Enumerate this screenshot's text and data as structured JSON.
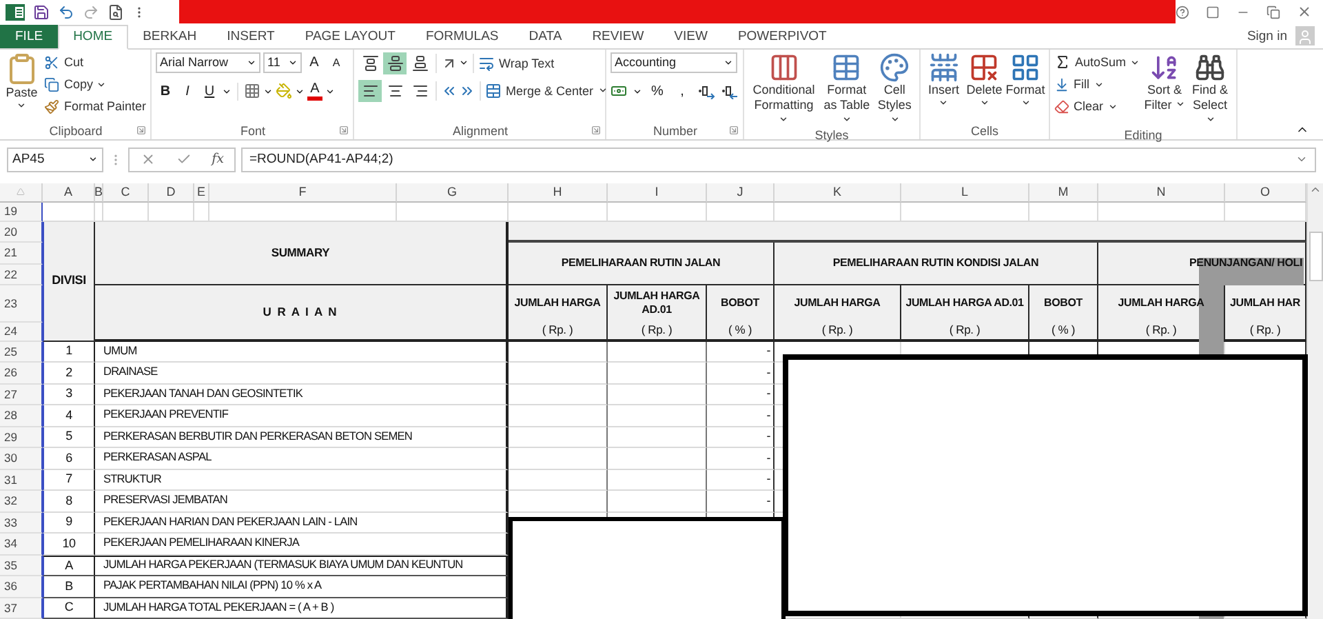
{
  "tabs": [
    {
      "label": "FILE",
      "kind": "file",
      "selected": false
    },
    {
      "label": "HOME",
      "kind": "tab",
      "selected": true
    },
    {
      "label": "BERKAH",
      "kind": "tab",
      "selected": false
    },
    {
      "label": "INSERT",
      "kind": "tab",
      "selected": false
    },
    {
      "label": "PAGE LAYOUT",
      "kind": "tab",
      "selected": false
    },
    {
      "label": "FORMULAS",
      "kind": "tab",
      "selected": false
    },
    {
      "label": "DATA",
      "kind": "tab",
      "selected": false
    },
    {
      "label": "REVIEW",
      "kind": "tab",
      "selected": false
    },
    {
      "label": "VIEW",
      "kind": "tab",
      "selected": false
    },
    {
      "label": "POWERPIVOT",
      "kind": "tab",
      "selected": false
    }
  ],
  "account": {
    "label": "Sign in"
  },
  "ribbon": {
    "clipboard": {
      "title": "Clipboard",
      "paste": "Paste",
      "cut": "Cut",
      "copy": "Copy",
      "format_painter": "Format Painter"
    },
    "font": {
      "title": "Font",
      "name": "Arial Narrow",
      "size": "11",
      "grow": "A",
      "shrink": "A",
      "bold": "B",
      "italic": "I",
      "underline": "U",
      "font_color": "A"
    },
    "alignment": {
      "title": "Alignment",
      "vertical": [
        {
          "kind": "top",
          "selected": false
        },
        {
          "kind": "middle",
          "selected": true
        },
        {
          "kind": "bottom",
          "selected": false
        }
      ],
      "horizontal": [
        {
          "kind": "left",
          "selected": true
        },
        {
          "kind": "center",
          "selected": false
        },
        {
          "kind": "right",
          "selected": false
        }
      ],
      "wrap_text": "Wrap Text",
      "merge": "Merge & Center"
    },
    "number": {
      "title": "Number",
      "format": "Accounting",
      "percent": "%",
      "comma": ","
    },
    "styles": {
      "title": "Styles",
      "buttons": [
        {
          "label": "Conditional Formatting",
          "kind": "conditional"
        },
        {
          "label": "Format as Table",
          "kind": "table"
        },
        {
          "label": "Cell Styles",
          "kind": "cell"
        }
      ]
    },
    "cells": {
      "title": "Cells",
      "buttons": [
        {
          "label": "Insert",
          "kind": "insert"
        },
        {
          "label": "Delete",
          "kind": "delete"
        },
        {
          "label": "Format",
          "kind": "format"
        }
      ]
    },
    "editing": {
      "title": "Editing",
      "autosum": "AutoSum",
      "fill": "Fill",
      "clear": "Clear",
      "sort": "Sort & Filter",
      "find": "Find & Select"
    }
  },
  "formula_bar": {
    "name_box": "AP45",
    "fx": "fx",
    "formula": "=ROUND(AP41-AP44;2)"
  },
  "sheet": {
    "columns": [
      "A",
      "B",
      "C",
      "D",
      "E",
      "F",
      "G",
      "H",
      "I",
      "J",
      "K",
      "L",
      "M",
      "N",
      "O"
    ],
    "row_numbers": [
      "19",
      "20",
      "21",
      "22",
      "23",
      "24",
      "25",
      "26",
      "27",
      "28",
      "29",
      "30",
      "31",
      "32",
      "33",
      "34",
      "35",
      "36",
      "37"
    ],
    "divisi": "DIVISI",
    "summary": "SUMMARY",
    "uraian": "U R A I A N",
    "groups": [
      "PEMELIHARAAN RUTIN JALAN",
      "PEMELIHARAAN RUTIN KONDISI JALAN",
      "PENUNJANGAN/ HOLI"
    ],
    "subcolumns": [
      {
        "title": "JUMLAH HARGA",
        "unit": "( Rp. )"
      },
      {
        "title": "JUMLAH HARGA AD.01",
        "unit": "( Rp. )"
      },
      {
        "title": "BOBOT",
        "unit": "( % )"
      },
      {
        "title": "JUMLAH HARGA",
        "unit": "( Rp. )"
      },
      {
        "title": "JUMLAH HARGA AD.01",
        "unit": "( Rp. )"
      },
      {
        "title": "BOBOT",
        "unit": "( % )"
      },
      {
        "title": "JUMLAH HARGA",
        "unit": "( Rp. )"
      },
      {
        "title": "JUMLAH HAR",
        "unit": "( Rp. )"
      }
    ],
    "rows": [
      {
        "no": "1",
        "text": "UMUM",
        "kind": "item",
        "bobot": "-"
      },
      {
        "no": "2",
        "text": "DRAINASE",
        "kind": "item",
        "bobot": "-"
      },
      {
        "no": "3",
        "text": "PEKERJAAN TANAH DAN GEOSINTETIK",
        "kind": "item",
        "bobot": "-"
      },
      {
        "no": "4",
        "text": "PEKERJAAN PREVENTIF",
        "kind": "item",
        "bobot": "-"
      },
      {
        "no": "5",
        "text": "PERKERASAN BERBUTIR DAN PERKERASAN BETON SEMEN",
        "kind": "item",
        "bobot": "-"
      },
      {
        "no": "6",
        "text": "PERKERASAN ASPAL",
        "kind": "item",
        "bobot": "-"
      },
      {
        "no": "7",
        "text": "STRUKTUR",
        "kind": "item",
        "bobot": "-"
      },
      {
        "no": "8",
        "text": "PRESERVASI JEMBATAN",
        "kind": "item",
        "bobot": "-"
      },
      {
        "no": "9",
        "text": "PEKERJAAN HARIAN DAN PEKERJAAN LAIN - LAIN",
        "kind": "item"
      },
      {
        "no": "10",
        "text": "PEKERJAAN PEMELIHARAAN KINERJA",
        "kind": "item"
      },
      {
        "no": "A",
        "text": "JUMLAH HARGA PEKERJAAN (TERMASUK BIAYA UMUM DAN KEUNTUN",
        "kind": "total"
      },
      {
        "no": "B",
        "text": "PAJAK PERTAMBAHAN NILAI (PPN) 10 % x A",
        "kind": "total"
      },
      {
        "no": "C",
        "text": "JUMLAH HARGA TOTAL PEKERJAAN = ( A + B )",
        "kind": "total"
      }
    ]
  }
}
